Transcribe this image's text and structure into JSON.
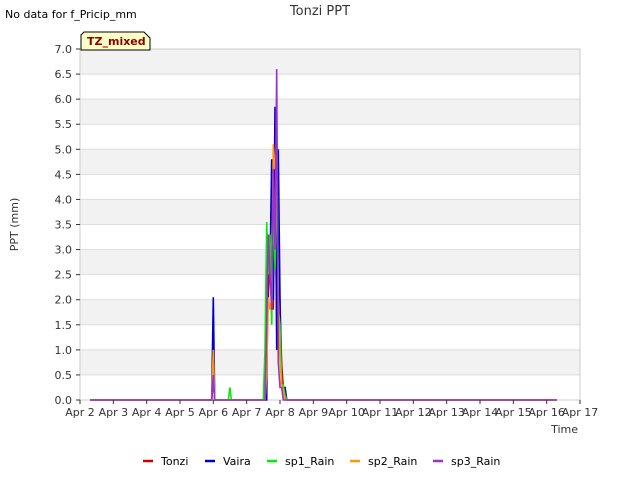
{
  "no_data_note": "No data for f_Pricip_mm",
  "chart_data": {
    "type": "line",
    "title": "Tonzi PPT",
    "xlabel": "Time",
    "ylabel": "PPT (mm)",
    "badge": "TZ_mixed",
    "xlim": [
      2,
      17
    ],
    "ylim": [
      0,
      7
    ],
    "x_ticks": [
      2,
      3,
      4,
      5,
      6,
      7,
      8,
      9,
      10,
      11,
      12,
      13,
      14,
      15,
      16,
      17
    ],
    "x_tick_labels": [
      "Apr 2",
      "Apr 3",
      "Apr 4",
      "Apr 5",
      "Apr 6",
      "Apr 7",
      "Apr 8",
      "Apr 9",
      "Apr 10",
      "Apr 11",
      "Apr 12",
      "Apr 13",
      "Apr 14",
      "Apr 15",
      "Apr 16",
      "Apr 17"
    ],
    "y_ticks": [
      0.0,
      0.5,
      1.0,
      1.5,
      2.0,
      2.5,
      3.0,
      3.5,
      4.0,
      4.5,
      5.0,
      5.5,
      6.0,
      6.5,
      7.0
    ],
    "y_tick_labels": [
      "0.0",
      "0.5",
      "1.0",
      "1.5",
      "2.0",
      "2.5",
      "3.0",
      "3.5",
      "4.0",
      "4.5",
      "5.0",
      "5.5",
      "6.0",
      "6.5",
      "7.0"
    ],
    "grid": true,
    "legend_position": "bottom",
    "series": [
      {
        "name": "Tonzi",
        "color": "#cc0000",
        "x": [
          2.3,
          5.95,
          6.0,
          6.04,
          7.55,
          7.6,
          7.65,
          7.7,
          7.75,
          7.8,
          7.85,
          7.9,
          7.95,
          8.0,
          8.05,
          8.1,
          8.15,
          8.2,
          8.25,
          16.3
        ],
        "y": [
          0,
          0,
          0.4,
          0,
          0,
          3.0,
          2.0,
          3.3,
          2.2,
          1.8,
          4.6,
          2.5,
          3.6,
          1.8,
          0.7,
          0.25,
          0.25,
          0,
          0,
          0
        ]
      },
      {
        "name": "Vaira",
        "color": "#0000cc",
        "x": [
          2.3,
          5.95,
          6.0,
          6.04,
          7.6,
          7.65,
          7.7,
          7.75,
          7.8,
          7.85,
          7.9,
          7.95,
          8.0,
          8.05,
          8.1,
          8.15,
          8.2,
          16.3
        ],
        "y": [
          0,
          0,
          2.05,
          0,
          0,
          3.3,
          2.6,
          4.8,
          2.0,
          5.85,
          1.0,
          5.0,
          2.0,
          0.3,
          0.25,
          0.25,
          0,
          0
        ]
      },
      {
        "name": "sp1_Rain",
        "color": "#00ee00",
        "x": [
          2.3,
          6.45,
          6.5,
          6.54,
          7.5,
          7.55,
          7.6,
          7.65,
          7.7,
          7.75,
          7.8,
          7.85,
          7.9,
          7.95,
          8.0,
          8.05,
          8.1,
          8.15,
          8.2,
          16.3
        ],
        "y": [
          0,
          0,
          0.25,
          0,
          0,
          1.0,
          3.55,
          2.5,
          3.3,
          1.5,
          4.0,
          2.6,
          4.8,
          1.8,
          1.5,
          0.3,
          0.3,
          0.1,
          0,
          0
        ]
      },
      {
        "name": "sp2_Rain",
        "color": "#ff9900",
        "x": [
          2.3,
          5.95,
          6.0,
          6.04,
          7.55,
          7.6,
          7.65,
          7.7,
          7.75,
          7.8,
          7.85,
          7.9,
          7.95,
          8.0,
          8.05,
          8.1,
          8.15,
          16.3
        ],
        "y": [
          0,
          0,
          1.0,
          0,
          0,
          0.5,
          2.05,
          1.8,
          2.0,
          5.1,
          4.6,
          5.1,
          2.0,
          0.8,
          0.3,
          0.2,
          0,
          0
        ]
      },
      {
        "name": "sp3_Rain",
        "color": "#9933cc",
        "x": [
          2.3,
          5.95,
          6.0,
          6.04,
          7.55,
          7.6,
          7.65,
          7.7,
          7.75,
          7.8,
          7.85,
          7.9,
          7.95,
          8.0,
          8.05,
          8.1,
          16.3
        ],
        "y": [
          0,
          0,
          0.5,
          0,
          0,
          1.5,
          3.3,
          2.5,
          1.8,
          4.6,
          3.0,
          6.6,
          0.75,
          0.25,
          0.25,
          0,
          0
        ]
      }
    ]
  }
}
